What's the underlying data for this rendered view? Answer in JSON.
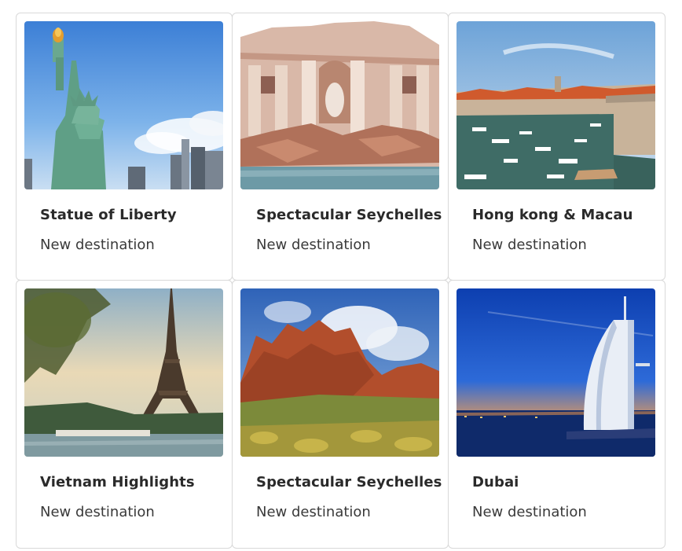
{
  "cards": [
    {
      "title": "Statue of Liberty",
      "subtitle": "New destination",
      "image": "statue-of-liberty-photo"
    },
    {
      "title": "Spectacular Seychelles",
      "subtitle": "New destination",
      "image": "trevi-fountain-photo"
    },
    {
      "title": "Hong kong & Macau",
      "subtitle": "New destination",
      "image": "harbor-town-photo"
    },
    {
      "title": "Vietnam Highlights",
      "subtitle": "New destination",
      "image": "eiffel-tower-photo"
    },
    {
      "title": "Spectacular Seychelles",
      "subtitle": "New destination",
      "image": "desert-mountains-photo"
    },
    {
      "title": "Dubai",
      "subtitle": "New destination",
      "image": "burj-al-arab-photo"
    }
  ]
}
